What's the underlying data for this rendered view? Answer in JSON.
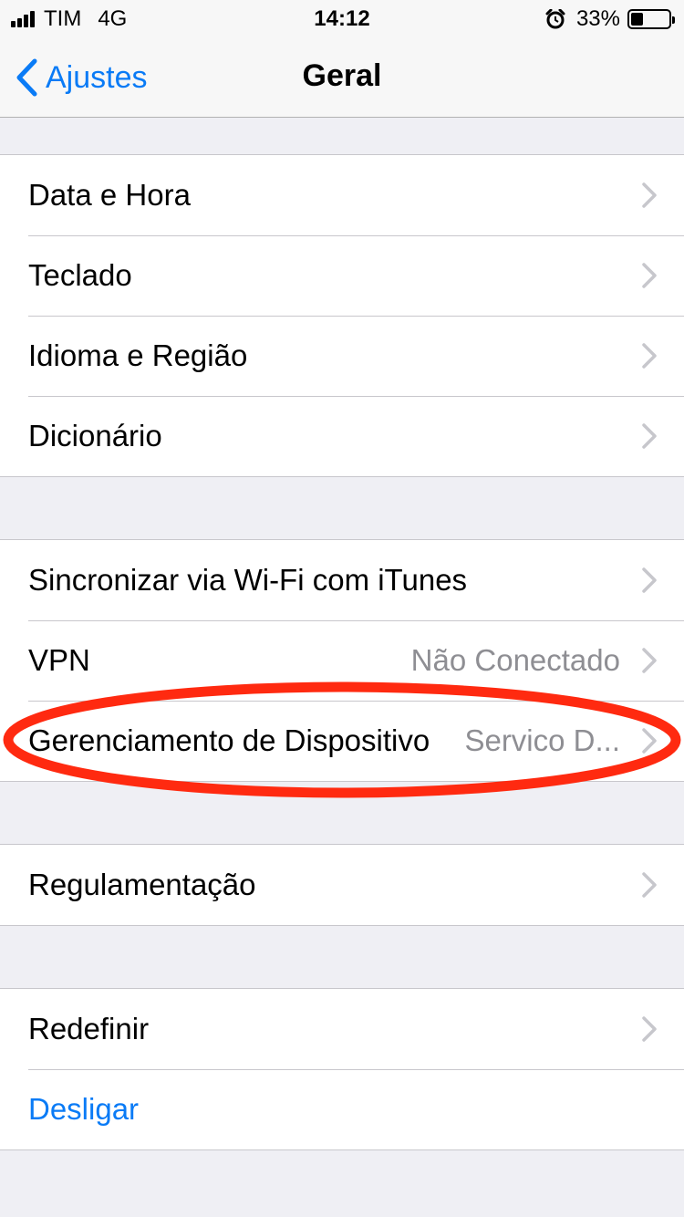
{
  "status_bar": {
    "carrier": "TIM",
    "network": "4G",
    "time": "14:12",
    "battery_percent": "33%",
    "battery_level": 0.33,
    "icons": [
      "signal-icon",
      "alarm-icon",
      "battery-icon"
    ]
  },
  "nav": {
    "back_label": "Ajustes",
    "title": "Geral"
  },
  "groups": [
    {
      "rows": [
        {
          "label": "Data e Hora"
        },
        {
          "label": "Teclado"
        },
        {
          "label": "Idioma e Região"
        },
        {
          "label": "Dicionário"
        }
      ]
    },
    {
      "rows": [
        {
          "label": "Sincronizar via Wi-Fi com iTunes"
        },
        {
          "label": "VPN",
          "value": "Não Conectado"
        },
        {
          "label": "Gerenciamento de Dispositivo",
          "value": "Servico D..."
        }
      ]
    },
    {
      "rows": [
        {
          "label": "Regulamentação"
        }
      ]
    },
    {
      "rows": [
        {
          "label": "Redefinir"
        },
        {
          "label": "Desligar"
        }
      ]
    }
  ],
  "colors": {
    "accent": "#0a7bf6",
    "background": "#efeff4",
    "annotation": "#ff2a10",
    "secondary_text": "#8e8e93",
    "chevron": "#c7c7cc"
  }
}
